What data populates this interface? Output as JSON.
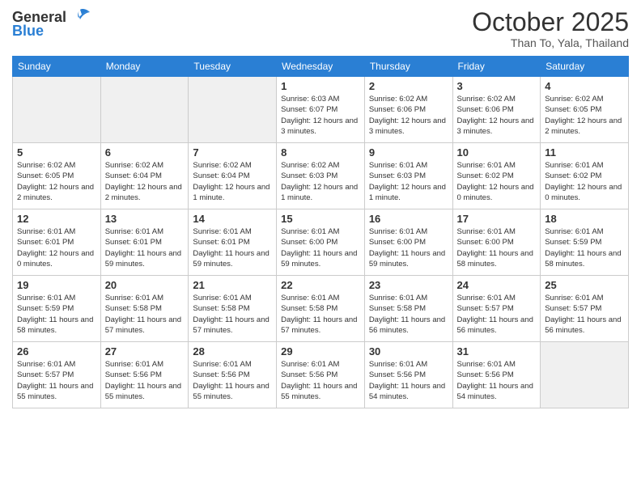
{
  "header": {
    "logo_line1": "General",
    "logo_line2": "Blue",
    "month": "October 2025",
    "location": "Than To, Yala, Thailand"
  },
  "days_of_week": [
    "Sunday",
    "Monday",
    "Tuesday",
    "Wednesday",
    "Thursday",
    "Friday",
    "Saturday"
  ],
  "weeks": [
    [
      {
        "day": "",
        "empty": true
      },
      {
        "day": "",
        "empty": true
      },
      {
        "day": "",
        "empty": true
      },
      {
        "day": "1",
        "sunrise": "Sunrise: 6:03 AM",
        "sunset": "Sunset: 6:07 PM",
        "daylight": "Daylight: 12 hours and 3 minutes."
      },
      {
        "day": "2",
        "sunrise": "Sunrise: 6:02 AM",
        "sunset": "Sunset: 6:06 PM",
        "daylight": "Daylight: 12 hours and 3 minutes."
      },
      {
        "day": "3",
        "sunrise": "Sunrise: 6:02 AM",
        "sunset": "Sunset: 6:06 PM",
        "daylight": "Daylight: 12 hours and 3 minutes."
      },
      {
        "day": "4",
        "sunrise": "Sunrise: 6:02 AM",
        "sunset": "Sunset: 6:05 PM",
        "daylight": "Daylight: 12 hours and 2 minutes."
      }
    ],
    [
      {
        "day": "5",
        "sunrise": "Sunrise: 6:02 AM",
        "sunset": "Sunset: 6:05 PM",
        "daylight": "Daylight: 12 hours and 2 minutes."
      },
      {
        "day": "6",
        "sunrise": "Sunrise: 6:02 AM",
        "sunset": "Sunset: 6:04 PM",
        "daylight": "Daylight: 12 hours and 2 minutes."
      },
      {
        "day": "7",
        "sunrise": "Sunrise: 6:02 AM",
        "sunset": "Sunset: 6:04 PM",
        "daylight": "Daylight: 12 hours and 1 minute."
      },
      {
        "day": "8",
        "sunrise": "Sunrise: 6:02 AM",
        "sunset": "Sunset: 6:03 PM",
        "daylight": "Daylight: 12 hours and 1 minute."
      },
      {
        "day": "9",
        "sunrise": "Sunrise: 6:01 AM",
        "sunset": "Sunset: 6:03 PM",
        "daylight": "Daylight: 12 hours and 1 minute."
      },
      {
        "day": "10",
        "sunrise": "Sunrise: 6:01 AM",
        "sunset": "Sunset: 6:02 PM",
        "daylight": "Daylight: 12 hours and 0 minutes."
      },
      {
        "day": "11",
        "sunrise": "Sunrise: 6:01 AM",
        "sunset": "Sunset: 6:02 PM",
        "daylight": "Daylight: 12 hours and 0 minutes."
      }
    ],
    [
      {
        "day": "12",
        "sunrise": "Sunrise: 6:01 AM",
        "sunset": "Sunset: 6:01 PM",
        "daylight": "Daylight: 12 hours and 0 minutes."
      },
      {
        "day": "13",
        "sunrise": "Sunrise: 6:01 AM",
        "sunset": "Sunset: 6:01 PM",
        "daylight": "Daylight: 11 hours and 59 minutes."
      },
      {
        "day": "14",
        "sunrise": "Sunrise: 6:01 AM",
        "sunset": "Sunset: 6:01 PM",
        "daylight": "Daylight: 11 hours and 59 minutes."
      },
      {
        "day": "15",
        "sunrise": "Sunrise: 6:01 AM",
        "sunset": "Sunset: 6:00 PM",
        "daylight": "Daylight: 11 hours and 59 minutes."
      },
      {
        "day": "16",
        "sunrise": "Sunrise: 6:01 AM",
        "sunset": "Sunset: 6:00 PM",
        "daylight": "Daylight: 11 hours and 59 minutes."
      },
      {
        "day": "17",
        "sunrise": "Sunrise: 6:01 AM",
        "sunset": "Sunset: 6:00 PM",
        "daylight": "Daylight: 11 hours and 58 minutes."
      },
      {
        "day": "18",
        "sunrise": "Sunrise: 6:01 AM",
        "sunset": "Sunset: 5:59 PM",
        "daylight": "Daylight: 11 hours and 58 minutes."
      }
    ],
    [
      {
        "day": "19",
        "sunrise": "Sunrise: 6:01 AM",
        "sunset": "Sunset: 5:59 PM",
        "daylight": "Daylight: 11 hours and 58 minutes."
      },
      {
        "day": "20",
        "sunrise": "Sunrise: 6:01 AM",
        "sunset": "Sunset: 5:58 PM",
        "daylight": "Daylight: 11 hours and 57 minutes."
      },
      {
        "day": "21",
        "sunrise": "Sunrise: 6:01 AM",
        "sunset": "Sunset: 5:58 PM",
        "daylight": "Daylight: 11 hours and 57 minutes."
      },
      {
        "day": "22",
        "sunrise": "Sunrise: 6:01 AM",
        "sunset": "Sunset: 5:58 PM",
        "daylight": "Daylight: 11 hours and 57 minutes."
      },
      {
        "day": "23",
        "sunrise": "Sunrise: 6:01 AM",
        "sunset": "Sunset: 5:58 PM",
        "daylight": "Daylight: 11 hours and 56 minutes."
      },
      {
        "day": "24",
        "sunrise": "Sunrise: 6:01 AM",
        "sunset": "Sunset: 5:57 PM",
        "daylight": "Daylight: 11 hours and 56 minutes."
      },
      {
        "day": "25",
        "sunrise": "Sunrise: 6:01 AM",
        "sunset": "Sunset: 5:57 PM",
        "daylight": "Daylight: 11 hours and 56 minutes."
      }
    ],
    [
      {
        "day": "26",
        "sunrise": "Sunrise: 6:01 AM",
        "sunset": "Sunset: 5:57 PM",
        "daylight": "Daylight: 11 hours and 55 minutes."
      },
      {
        "day": "27",
        "sunrise": "Sunrise: 6:01 AM",
        "sunset": "Sunset: 5:56 PM",
        "daylight": "Daylight: 11 hours and 55 minutes."
      },
      {
        "day": "28",
        "sunrise": "Sunrise: 6:01 AM",
        "sunset": "Sunset: 5:56 PM",
        "daylight": "Daylight: 11 hours and 55 minutes."
      },
      {
        "day": "29",
        "sunrise": "Sunrise: 6:01 AM",
        "sunset": "Sunset: 5:56 PM",
        "daylight": "Daylight: 11 hours and 55 minutes."
      },
      {
        "day": "30",
        "sunrise": "Sunrise: 6:01 AM",
        "sunset": "Sunset: 5:56 PM",
        "daylight": "Daylight: 11 hours and 54 minutes."
      },
      {
        "day": "31",
        "sunrise": "Sunrise: 6:01 AM",
        "sunset": "Sunset: 5:56 PM",
        "daylight": "Daylight: 11 hours and 54 minutes."
      },
      {
        "day": "",
        "empty": true
      }
    ]
  ]
}
